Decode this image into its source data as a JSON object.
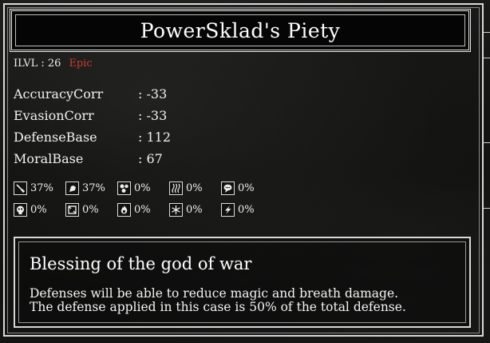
{
  "item": {
    "title": "PowerSklad's Piety",
    "ilvl_label": "ILVL : 26",
    "rarity": "Epic",
    "rarity_color": "#d23a2e"
  },
  "stats": [
    {
      "name": "AccuracyCorr",
      "value": ": -33"
    },
    {
      "name": "EvasionCorr",
      "value": ": -33"
    },
    {
      "name": "DefenseBase",
      "value": ": 112"
    },
    {
      "name": "MoralBase",
      "value": ": 67"
    }
  ],
  "resistances": [
    {
      "icon": "sword-icon",
      "value": "37%"
    },
    {
      "icon": "claw-icon",
      "value": "37%"
    },
    {
      "icon": "orbs-icon",
      "value": "0%"
    },
    {
      "icon": "wave-icon",
      "value": "0%"
    },
    {
      "icon": "speech-icon",
      "value": "0%"
    },
    {
      "icon": "skull-icon",
      "value": "0%"
    },
    {
      "icon": "frame-icon",
      "value": "0%"
    },
    {
      "icon": "fire-icon",
      "value": "0%"
    },
    {
      "icon": "snowflake-icon",
      "value": "0%"
    },
    {
      "icon": "lightning-icon",
      "value": "0%"
    }
  ],
  "description": {
    "title": "Blessing of the god of war",
    "line1": "Defenses will be able to reduce magic and breath damage.",
    "line2": "The defense applied in this case is 50% of the total defense."
  }
}
